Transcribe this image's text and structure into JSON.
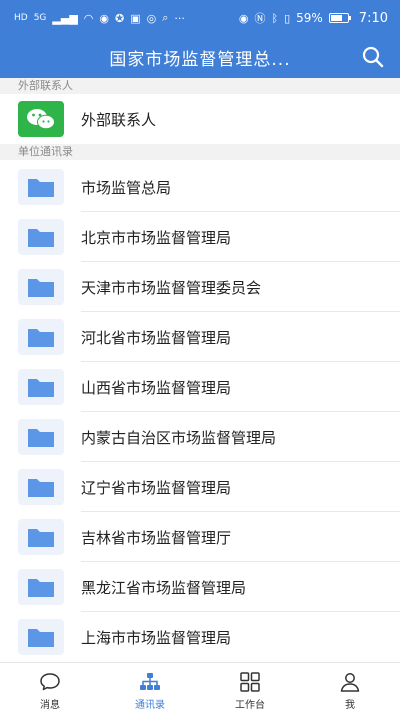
{
  "status_bar": {
    "left_badges": [
      "HD",
      "5G"
    ],
    "battery_percent": "59%",
    "battery_level": 0.59,
    "time": "7:10"
  },
  "header": {
    "title": "国家市场监督管理总..."
  },
  "sections": {
    "external": {
      "label": "外部联系人",
      "items": [
        {
          "label": "外部联系人",
          "icon": "wechat-icon"
        }
      ]
    },
    "directory": {
      "label": "单位通讯录",
      "items": [
        {
          "label": "市场监管总局",
          "icon": "folder-icon"
        },
        {
          "label": "北京市市场监督管理局",
          "icon": "folder-icon"
        },
        {
          "label": "天津市市场监督管理委员会",
          "icon": "folder-icon"
        },
        {
          "label": "河北省市场监督管理局",
          "icon": "folder-icon"
        },
        {
          "label": "山西省市场监督管理局",
          "icon": "folder-icon"
        },
        {
          "label": "内蒙古自治区市场监督管理局",
          "icon": "folder-icon"
        },
        {
          "label": "辽宁省市场监督管理局",
          "icon": "folder-icon"
        },
        {
          "label": "吉林省市场监督管理厅",
          "icon": "folder-icon"
        },
        {
          "label": "黑龙江省市场监督管理局",
          "icon": "folder-icon"
        },
        {
          "label": "上海市市场监督管理局",
          "icon": "folder-icon"
        }
      ]
    }
  },
  "tabbar": {
    "active_index": 1,
    "tabs": [
      {
        "label": "消息",
        "icon": "chat-bubble-icon"
      },
      {
        "label": "通讯录",
        "icon": "org-chart-icon"
      },
      {
        "label": "工作台",
        "icon": "grid-icon"
      },
      {
        "label": "我",
        "icon": "person-icon"
      }
    ]
  },
  "colors": {
    "primary": "#3f7fd8",
    "folder": "#5b97e6",
    "wechat": "#2fb44a"
  }
}
